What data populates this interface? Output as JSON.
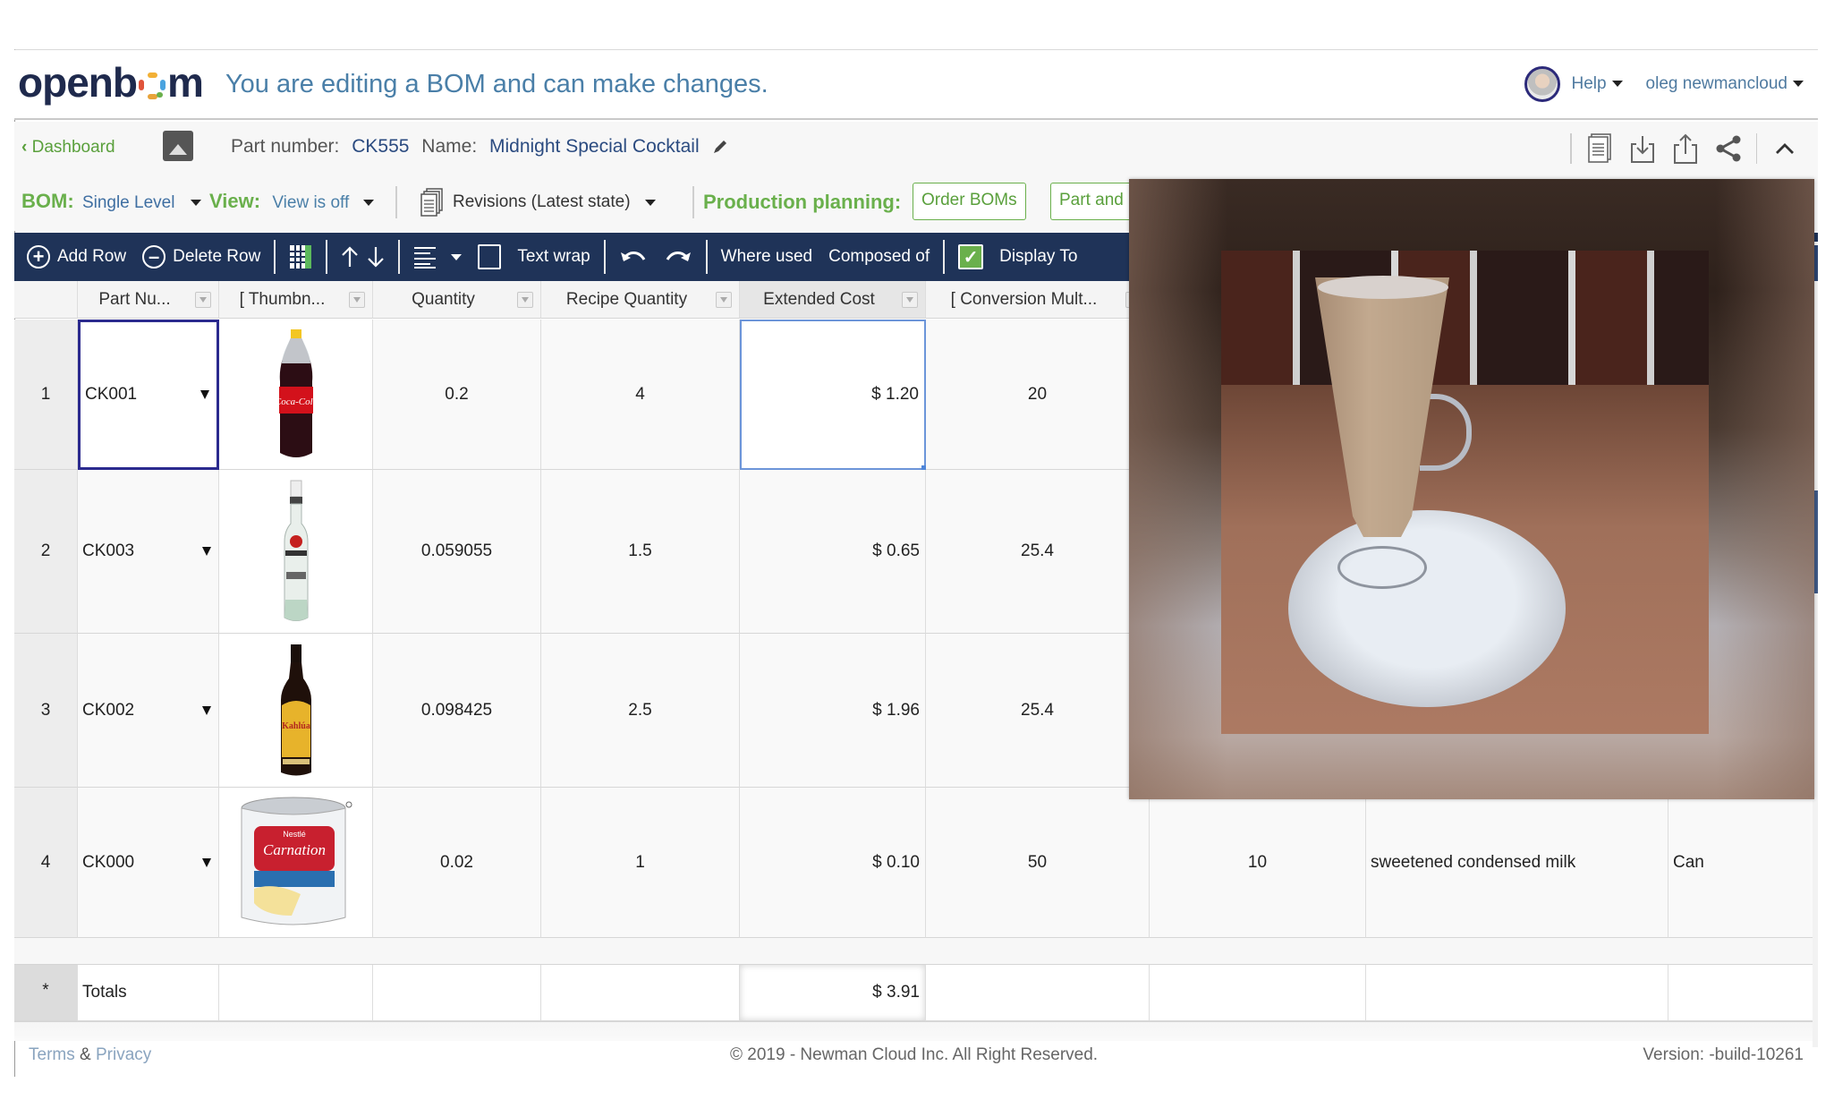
{
  "header": {
    "logo_text_a": "openb",
    "logo_text_b": "m",
    "edit_message": "You are editing a BOM and can make changes.",
    "help_label": "Help",
    "user_name": "oleg newmancloud"
  },
  "breadcrumb": {
    "dashboard_label": "Dashboard",
    "part_number_label": "Part number:",
    "part_number_value": "CK555",
    "name_label": "Name:",
    "name_value": "Midnight Special Cocktail"
  },
  "bom_bar": {
    "bom_label": "BOM:",
    "bom_value": "Single Level",
    "view_label": "View:",
    "view_value": "View is off",
    "revisions_label": "Revisions (Latest state)",
    "production_label": "Production planning:",
    "order_boms_label": "Order BOMs",
    "part_and_label": "Part and"
  },
  "toolbar": {
    "add_row": "Add Row",
    "delete_row": "Delete Row",
    "text_wrap": "Text wrap",
    "where_used": "Where used",
    "composed_of": "Composed of",
    "display_totals": "Display To",
    "text_wrap_checked": false,
    "display_totals_checked": true
  },
  "grid": {
    "columns": [
      {
        "label": "Part Nu..."
      },
      {
        "label": "[ Thumbn..."
      },
      {
        "label": "Quantity"
      },
      {
        "label": "Recipe Quantity"
      },
      {
        "label": "Extended Cost"
      },
      {
        "label": "[ Conversion Mult..."
      }
    ],
    "rows": [
      {
        "num": "1",
        "part": "CK001",
        "thumb": "coca-cola-bottle",
        "qty": "0.2",
        "recipe": "4",
        "ext": "$ 1.20",
        "conv": "20",
        "col8": "",
        "desc": "",
        "unit": ""
      },
      {
        "num": "2",
        "part": "CK003",
        "thumb": "bacardi-bottle",
        "qty": "0.059055",
        "recipe": "1.5",
        "ext": "$ 0.65",
        "conv": "25.4",
        "col8": "",
        "desc": "",
        "unit": ""
      },
      {
        "num": "3",
        "part": "CK002",
        "thumb": "kahlua-bottle",
        "qty": "0.098425",
        "recipe": "2.5",
        "ext": "$ 1.96",
        "conv": "25.4",
        "col8": "",
        "desc": "",
        "unit": ""
      },
      {
        "num": "4",
        "part": "CK000",
        "thumb": "carnation-can",
        "qty": "0.02",
        "recipe": "1",
        "ext": "$ 0.10",
        "conv": "50",
        "col8": "10",
        "desc": "sweetened condensed milk",
        "unit": "Can"
      }
    ],
    "totals": {
      "marker": "*",
      "label": "Totals",
      "ext": "$ 3.91"
    }
  },
  "popup": {
    "subject": "cocktail-photo"
  },
  "footer": {
    "terms": "Terms",
    "amp": "&",
    "privacy": "Privacy",
    "copyright": "© 2019 - Newman Cloud Inc. All Right Reserved.",
    "version": "Version: -build-10261"
  },
  "colors": {
    "toolbar_bg": "#1f3358",
    "accent_green": "#6ab04c",
    "link_blue": "#4a7fa8",
    "selection_border": "#2b2a8e",
    "active_cell_border": "#6c95d9"
  }
}
